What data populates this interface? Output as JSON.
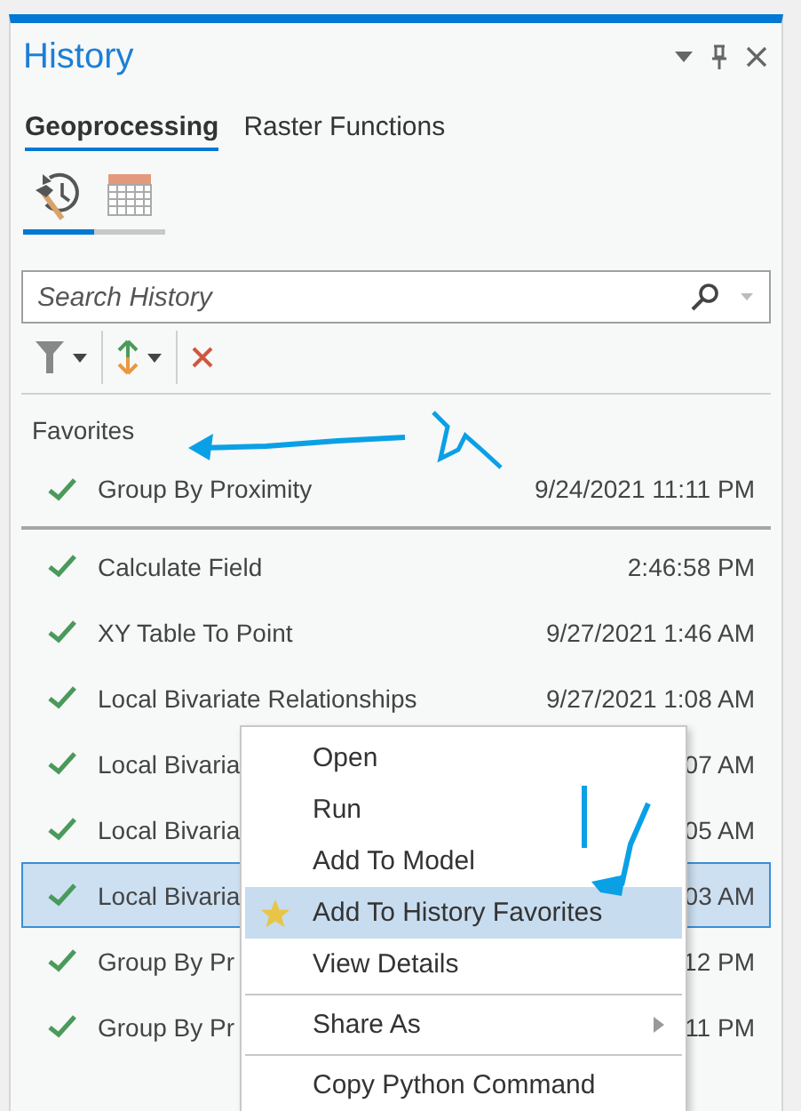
{
  "panel": {
    "title": "History"
  },
  "tabs": [
    {
      "label": "Geoprocessing",
      "selected": true
    },
    {
      "label": "Raster Functions",
      "selected": false
    }
  ],
  "views": [
    {
      "kind": "history",
      "selected": true
    },
    {
      "kind": "calendar",
      "selected": false
    }
  ],
  "search": {
    "placeholder": "Search History"
  },
  "favorites": {
    "heading": "Favorites",
    "rows": [
      {
        "name": "Group By Proximity",
        "time": "9/24/2021 11:11 PM",
        "selected": false
      }
    ]
  },
  "rows": [
    {
      "name": "Calculate Field",
      "time": "2:46:58 PM",
      "selected": false
    },
    {
      "name": "XY Table To Point",
      "time": "9/27/2021 1:46 AM",
      "selected": false
    },
    {
      "name": "Local Bivariate Relationships",
      "time": "9/27/2021 1:08 AM",
      "selected": false
    },
    {
      "name": "Local Bivaria",
      "time": "07 AM",
      "selected": false
    },
    {
      "name": "Local Bivaria",
      "time": "05 AM",
      "selected": false
    },
    {
      "name": "Local Bivaria",
      "time": "03 AM",
      "selected": true
    },
    {
      "name": "Group By Pr",
      "time": "12 PM",
      "selected": false
    },
    {
      "name": "Group By Pr",
      "time": "11 PM",
      "selected": false
    }
  ],
  "context_menu": {
    "groups": [
      [
        {
          "label": "Open",
          "kind": "plain",
          "selected": false
        },
        {
          "label": "Run",
          "kind": "plain",
          "selected": false
        },
        {
          "label": "Add To Model",
          "kind": "plain",
          "selected": false
        },
        {
          "label": "Add To History Favorites",
          "kind": "starred",
          "selected": true
        },
        {
          "label": "View Details",
          "kind": "plain",
          "selected": false
        }
      ],
      [
        {
          "label": "Share As",
          "kind": "submenu",
          "selected": false
        }
      ],
      [
        {
          "label": "Copy Python Command",
          "kind": "plain",
          "selected": false
        }
      ]
    ]
  }
}
